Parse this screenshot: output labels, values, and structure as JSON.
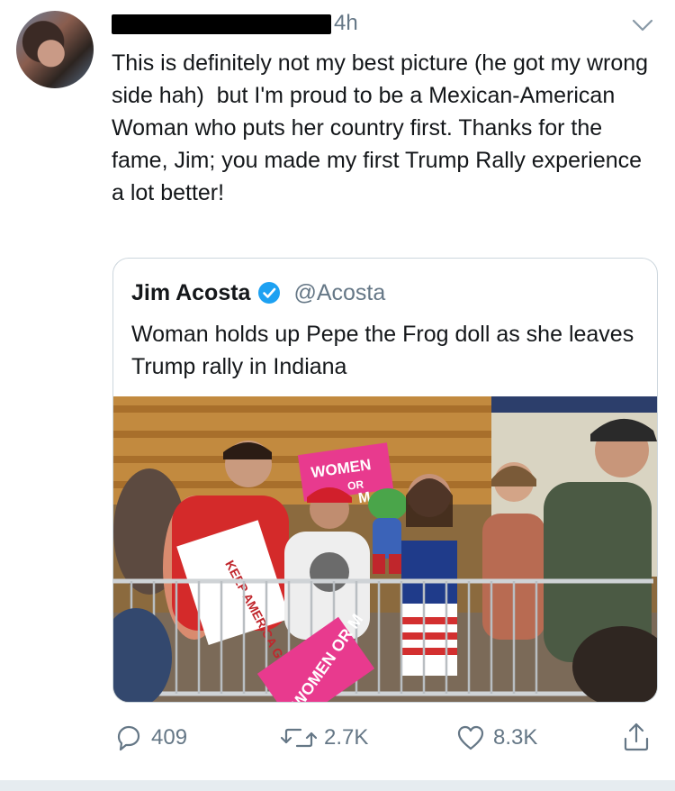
{
  "tweet": {
    "handle_prefix": "@",
    "time": "4h",
    "text": "This is definitely not my best picture (he got my wrong side hah)  but I'm proud to be a Mexican-American Woman who puts her country first. Thanks for the fame, Jim; you made my first Trump Rally experience a lot better!"
  },
  "quoted": {
    "name": "Jim Acosta",
    "handle": "@Acosta",
    "text": "Woman holds up Pepe the Frog doll as she leaves Trump rally in Indiana",
    "photo_signs": {
      "women_sign": "WOMEN",
      "women_sign_line2": "OR",
      "women_sign_line3": "M",
      "keep_america_sign": "KEEP AMERICA GREAT",
      "bottom_sign": "WOMEN OR M"
    }
  },
  "actions": {
    "replies": "409",
    "retweets": "2.7K",
    "likes": "8.3K"
  },
  "colors": {
    "text": "#14171a",
    "muted": "#657786",
    "verified": "#1da1f2",
    "border": "#ccd6dd"
  }
}
